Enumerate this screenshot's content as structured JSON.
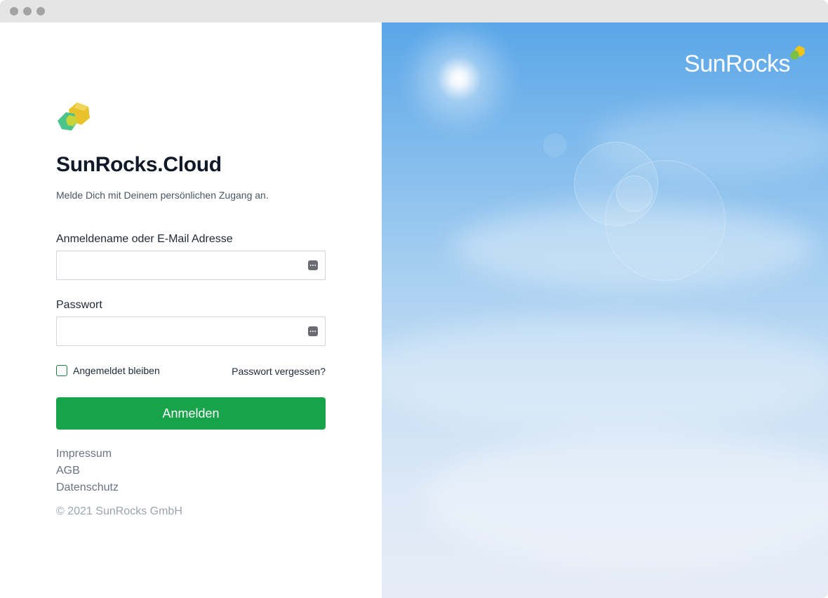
{
  "window": {
    "controls": [
      "close",
      "minimize",
      "maximize"
    ]
  },
  "login": {
    "logo_icon": "sunrocks-hexagon-logo",
    "title": "SunRocks.Cloud",
    "subtitle": "Melde Dich mit Deinem persönlichen Zugang an.",
    "username_label": "Anmeldename oder E-Mail Adresse",
    "username_value": "",
    "password_label": "Passwort",
    "password_value": "",
    "password_manager_icon": "password-manager-icon",
    "remember_label": "Angemeldet bleiben",
    "remember_checked": false,
    "forgot_label": "Passwort vergessen?",
    "submit_label": "Anmelden"
  },
  "footer": {
    "links": [
      "Impressum",
      "AGB",
      "Datenschutz"
    ],
    "copyright": "© 2021 SunRocks GmbH"
  },
  "hero": {
    "brand": "SunRocks"
  },
  "colors": {
    "accent": "#17a34a",
    "title": "#111827",
    "link_muted": "#6b7280",
    "sky": "#7db9ec"
  }
}
